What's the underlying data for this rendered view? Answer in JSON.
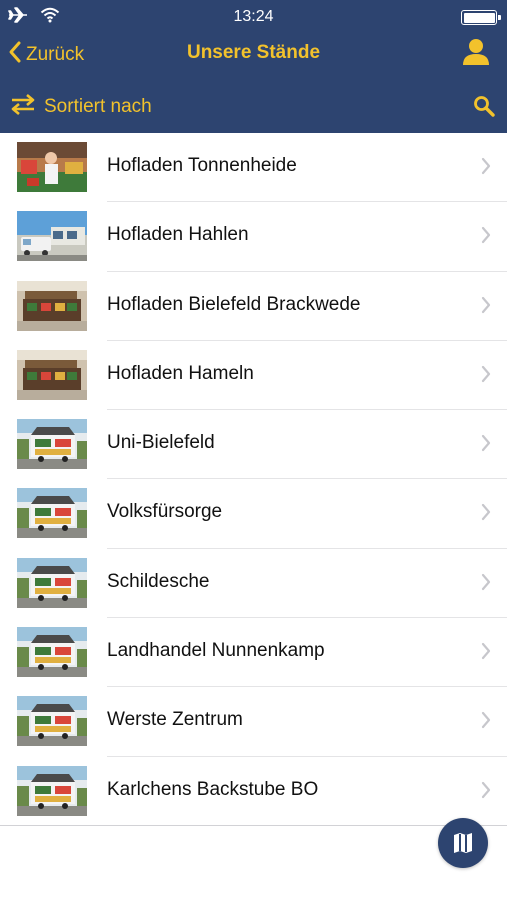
{
  "status_bar": {
    "time": "13:24",
    "battery_level": 1.0
  },
  "nav": {
    "back_label": "Zurück",
    "title": "Unsere Stände"
  },
  "toolbar": {
    "sort_label": "Sortiert nach"
  },
  "colors": {
    "header_bg": "#2d4470",
    "accent": "#f2c22c",
    "text": "#111111",
    "chevron": "#c7c7cc"
  },
  "items": [
    {
      "label": "Hofladen Tonnenheide",
      "thumb": "shop-interior-vendor"
    },
    {
      "label": "Hofladen Hahlen",
      "thumb": "storefront-sky"
    },
    {
      "label": "Hofladen Bielefeld Brackwede",
      "thumb": "market-stand-interior"
    },
    {
      "label": "Hofladen Hameln",
      "thumb": "market-stand-interior"
    },
    {
      "label": "Uni-Bielefeld",
      "thumb": "sales-trailer"
    },
    {
      "label": "Volksfürsorge",
      "thumb": "sales-trailer"
    },
    {
      "label": "Schildesche",
      "thumb": "sales-trailer"
    },
    {
      "label": "Landhandel Nunnenkamp",
      "thumb": "sales-trailer"
    },
    {
      "label": "Werste Zentrum",
      "thumb": "sales-trailer"
    },
    {
      "label": "Karlchens Backstube BO",
      "thumb": "sales-trailer"
    }
  ]
}
